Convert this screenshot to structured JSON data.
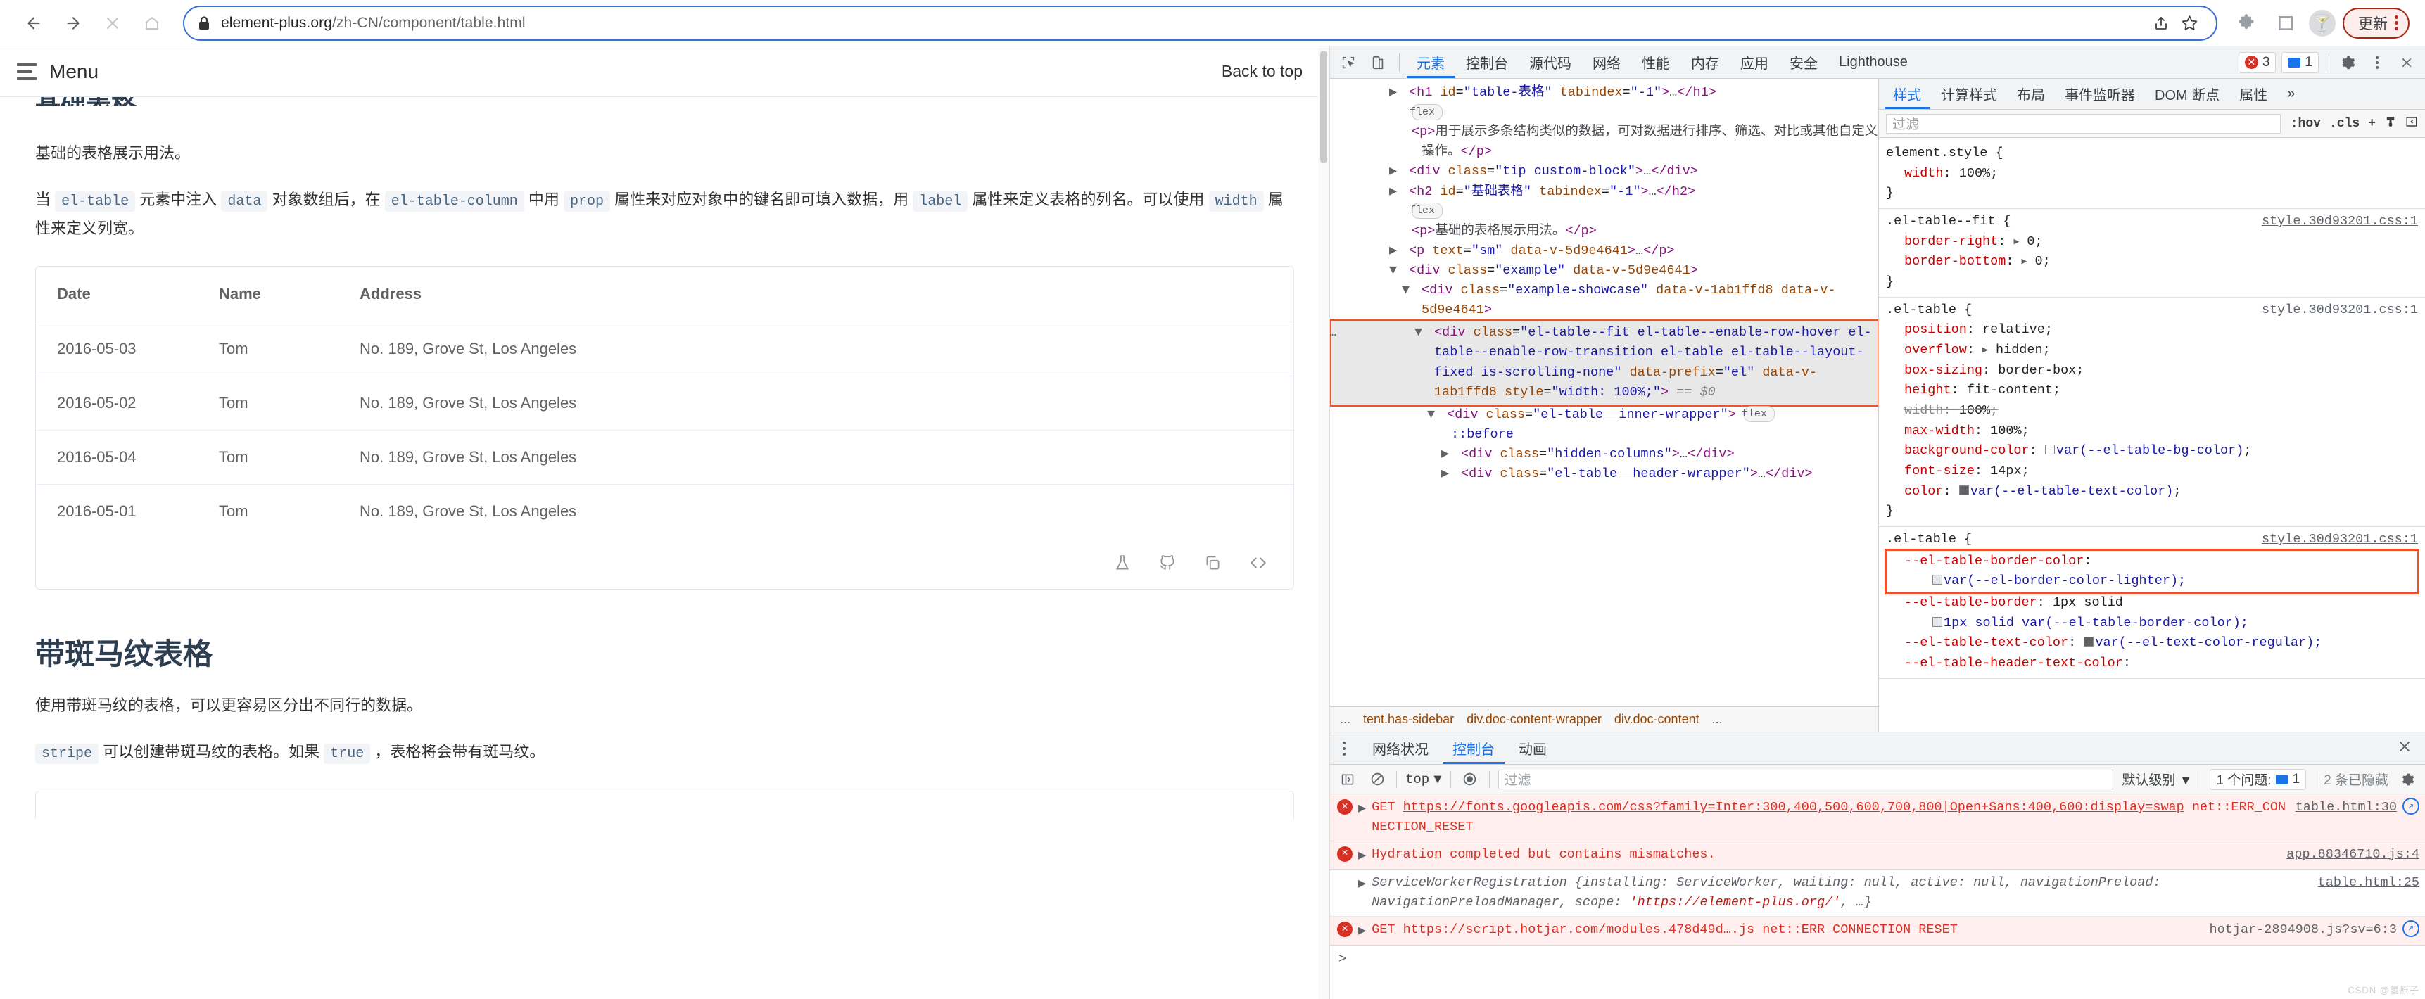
{
  "browser": {
    "nav": {
      "back": "back-arrow",
      "forward": "forward-arrow",
      "stop": "stop-x",
      "home": "home"
    },
    "address": {
      "lock_icon": "lock-icon",
      "url_prefix": "element-plus.org",
      "url_path": "/zh-CN/component/table.html",
      "share_icon": "share-icon",
      "bookmark_icon": "star-icon"
    },
    "extensions_icon": "puzzle-icon",
    "sidepanel_icon": "side-panel-icon",
    "profile_avatar": "cocktail-avatar",
    "update_label": "更新",
    "menu_icon": "kebab-menu-icon"
  },
  "page": {
    "nav": {
      "menu_label": "Menu",
      "back_to_top": "Back to top"
    },
    "clipped_heading": "基础表格",
    "intro": "基础的表格展示用法。",
    "usage_parts": {
      "p1": "当",
      "c1": "el-table",
      "p2": "元素中注入",
      "c2": "data",
      "p3": "对象数组后，在",
      "c3": "el-table-column",
      "p4": "中用",
      "c4": "prop",
      "p5": "属性来对应对象中的键名即可填入数据，用",
      "c5": "label",
      "p6": "属性来定义表格的列名。可以使用",
      "c6": "width",
      "p7": "属性来定义列宽。"
    },
    "table": {
      "headers": [
        "Date",
        "Name",
        "Address"
      ],
      "rows": [
        [
          "2016-05-03",
          "Tom",
          "No. 189, Grove St, Los Angeles"
        ],
        [
          "2016-05-02",
          "Tom",
          "No. 189, Grove St, Los Angeles"
        ],
        [
          "2016-05-04",
          "Tom",
          "No. 189, Grove St, Los Angeles"
        ],
        [
          "2016-05-01",
          "Tom",
          "No. 189, Grove St, Los Angeles"
        ]
      ]
    },
    "example_actions": [
      "beaker-icon",
      "github-icon",
      "copy-icon",
      "code-icon"
    ],
    "section2": {
      "title": "带斑马纹表格",
      "desc": "使用带斑马纹的表格，可以更容易区分出不同行的数据。",
      "tip_parts": {
        "c1": "stripe",
        "t1": "可以创建带斑马纹的表格。如果",
        "c2": "true",
        "t2": "，表格将会带有斑马纹。"
      }
    }
  },
  "devtools": {
    "toolbar": {
      "inspect_icon": "inspect-element-icon",
      "device_icon": "device-toolbar-icon",
      "tabs": [
        "元素",
        "控制台",
        "源代码",
        "网络",
        "性能",
        "内存",
        "应用",
        "安全",
        "Lighthouse"
      ],
      "active_tab": "元素",
      "error_count": "3",
      "message_count": "1",
      "settings_icon": "gear-icon",
      "more_icon": "kebab-menu-icon",
      "close_icon": "close-icon"
    },
    "dom": {
      "lines": [
        {
          "id": "h1",
          "text": "<h1 id=\"table-表格\" tabindex=\"-1\">…</h1>"
        },
        {
          "id": "flex1",
          "text": "flex"
        },
        {
          "id": "p1",
          "text": "<p>用于展示多条结构类似的数据，可对数据进行排序、筛选、对比或其他自定义操作。</p>"
        },
        {
          "id": "tip",
          "text": "<div class=\"tip custom-block\">…</div>"
        },
        {
          "id": "h2",
          "text": "<h2 id=\"基础表格\" tabindex=\"-1\">…</h2>"
        },
        {
          "id": "flex2",
          "text": "flex"
        },
        {
          "id": "p2",
          "text": "<p>基础的表格展示用法。</p>"
        },
        {
          "id": "p3",
          "text": "<p text=\"sm\" data-v-5d9e4641>…</p>"
        },
        {
          "id": "example",
          "text": "<div class=\"example\" data-v-5d9e4641>"
        },
        {
          "id": "showcase",
          "text": "<div class=\"example-showcase\" data-v-1ab1ffd8 data-v-5d9e4641>"
        },
        {
          "id": "eltable",
          "text": "<div class=\"el-table--fit el-table--enable-row-hover el-table--enable-row-transition el-table el-table--layout-fixed is-scrolling-none\" data-prefix=\"el\" data-v-1ab1ffd8 style=\"width: 100%;\"> == $0"
        },
        {
          "id": "innerwrap",
          "text": "<div class=\"el-table__inner-wrapper\">"
        },
        {
          "id": "before",
          "text": "::before"
        },
        {
          "id": "hiddencols",
          "text": "<div class=\"hidden-columns\">…</div>"
        },
        {
          "id": "headerwrap",
          "text": "<div class=\"el-table__header-wrapper\">…</div>"
        }
      ],
      "breadcrumb": [
        "...",
        "tent.has-sidebar",
        "div.doc-content-wrapper",
        "div.doc-content",
        "..."
      ]
    },
    "styles": {
      "tabs": [
        "样式",
        "计算样式",
        "布局",
        "事件监听器",
        "DOM 断点",
        "属性"
      ],
      "active_tab": "样式",
      "overflow_icon": "chevron-right-double",
      "filter_placeholder": "过滤",
      "tools": [
        ":hov",
        ".cls",
        "+",
        "paintbrush-icon",
        "sidebar-toggle-icon"
      ],
      "rules": [
        {
          "selector": "element.style",
          "source": "",
          "decls": [
            {
              "prop": "width",
              "value": "100%",
              "strike": false
            }
          ]
        },
        {
          "selector": ".el-table--fit",
          "source": "style.30d93201.css:1",
          "decls": [
            {
              "prop": "border-right",
              "value": "0",
              "expandable": true
            },
            {
              "prop": "border-bottom",
              "value": "0",
              "expandable": true
            }
          ]
        },
        {
          "selector": ".el-table",
          "source": "style.30d93201.css:1",
          "decls": [
            {
              "prop": "position",
              "value": "relative"
            },
            {
              "prop": "overflow",
              "value": "hidden",
              "expandable": true
            },
            {
              "prop": "box-sizing",
              "value": "border-box"
            },
            {
              "prop": "height",
              "value": "fit-content"
            },
            {
              "prop": "width",
              "value": "100%",
              "strike": true
            },
            {
              "prop": "max-width",
              "value": "100%"
            },
            {
              "prop": "background-color",
              "value": "var(--el-table-bg-color)",
              "swatch": "white"
            },
            {
              "prop": "font-size",
              "value": "14px"
            },
            {
              "prop": "color",
              "value": "var(--el-table-text-color)",
              "swatch": "dark"
            }
          ]
        },
        {
          "selector": ".el-table",
          "source": "style.30d93201.css:1",
          "decls": [
            {
              "prop": "--el-table-border-color",
              "value": "var(--el-border-color-lighter);",
              "swatch": "grey",
              "wrap": true
            },
            {
              "prop": "--el-table-border",
              "value": "1px solid var(--el-table-border-color);",
              "swatch": "grey",
              "wrap": true
            },
            {
              "prop": "--el-table-text-color",
              "value": "var(--el-text-color-regular);",
              "swatch": "dark"
            },
            {
              "prop": "--el-table-header-text-color",
              "value": "",
              "swatch": ""
            }
          ]
        }
      ]
    },
    "drawer": {
      "menu_icon": "kebab-menu-icon",
      "tabs": [
        "网络状况",
        "控制台",
        "动画"
      ],
      "active_tab": "控制台",
      "close_icon": "close-icon",
      "toolbar": {
        "sidebar_icon": "console-sidebar-icon",
        "clear_icon": "clear-console-icon",
        "context": "top",
        "eye_icon": "live-expression-icon",
        "filter_placeholder": "过滤",
        "level": "默认级别",
        "issues_label": "1 个问题:",
        "issues_count": "1",
        "hidden_label": "2 条已隐藏",
        "settings_icon": "gear-icon"
      },
      "messages": [
        {
          "type": "error",
          "method": "GET",
          "url": "https://fonts.googleapis.com/css?family=Inter:300,400,500,600,700,800|Open+Sans:400,600:display=swap",
          "status": "net::ERR_CONNECTION_RESET",
          "source": "table.html:30",
          "has_request_icon": true
        },
        {
          "type": "error",
          "text": "Hydration completed but contains mismatches.",
          "source": "app.88346710.js:4"
        },
        {
          "type": "object",
          "source": "table.html:25",
          "text": "ServiceWorkerRegistration {installing: ServiceWorker, waiting: null, active: null, navigationPreload: NavigationPreloadManager, scope: 'https://element-plus.org/', …}"
        },
        {
          "type": "error",
          "method": "GET",
          "url": "https://script.hotjar.com/modules.478d49d….js",
          "status": "net::ERR_CONNECTION_RESET",
          "source": "hotjar-2894908.js?sv=6:3",
          "has_request_icon": true
        }
      ]
    }
  },
  "watermark": "CSDN @氢原子"
}
